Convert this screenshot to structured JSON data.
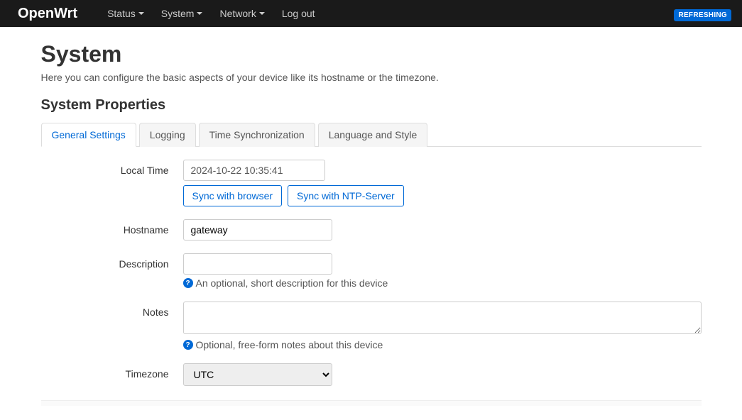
{
  "nav": {
    "brand": "OpenWrt",
    "items": [
      "Status",
      "System",
      "Network"
    ],
    "logout": "Log out",
    "badge": "REFRESHING"
  },
  "page": {
    "title": "System",
    "description": "Here you can configure the basic aspects of your device like its hostname or the timezone."
  },
  "section_title": "System Properties",
  "tabs": [
    "General Settings",
    "Logging",
    "Time Synchronization",
    "Language and Style"
  ],
  "form": {
    "local_time": {
      "label": "Local Time",
      "value": "2024-10-22 10:35:41",
      "sync_browser": "Sync with browser",
      "sync_ntp": "Sync with NTP-Server"
    },
    "hostname": {
      "label": "Hostname",
      "value": "gateway"
    },
    "description": {
      "label": "Description",
      "value": "",
      "hint": "An optional, short description for this device"
    },
    "notes": {
      "label": "Notes",
      "value": "",
      "hint": "Optional, free-form notes about this device"
    },
    "timezone": {
      "label": "Timezone",
      "value": "UTC"
    }
  }
}
